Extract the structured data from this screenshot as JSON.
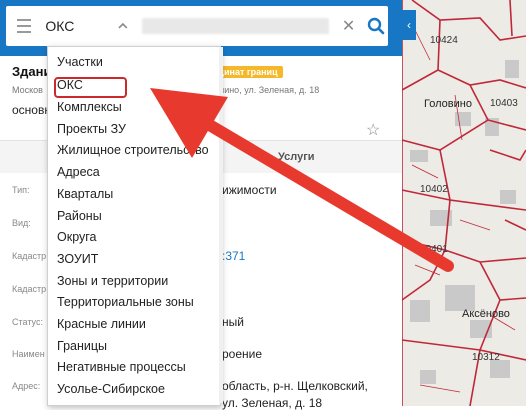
{
  "search": {
    "value": "ОКС",
    "clear_icon": "close-icon",
    "search_icon": "search-icon"
  },
  "object": {
    "title": "Здани",
    "badge": "рдинат границ",
    "subtitle_left": "Москов",
    "subtitle_right": "мино, ул. Зеленая, д. 18",
    "base_label": "основн"
  },
  "tabs": {
    "services": "Услуги"
  },
  "rows": [
    {
      "label": "Тип:",
      "value": "ижимости"
    },
    {
      "label": "Вид:",
      "value": ""
    },
    {
      "label": "Кадастр",
      "value": ":371"
    },
    {
      "label": "Кадастр",
      "value": ""
    },
    {
      "label": "Статус:",
      "value": "ный"
    },
    {
      "label": "Наимен",
      "value": "роение"
    },
    {
      "label": "Адрес:",
      "value": "область, р-н. Щелковский,"
    },
    {
      "label": "",
      "value": "ул. Зеленая, д. 18"
    }
  ],
  "dropdown": {
    "items": [
      "Участки",
      "ОКС",
      "Комплексы",
      "Проекты ЗУ",
      "Жилищное строительство",
      "Адреса",
      "Кварталы",
      "Районы",
      "Округа",
      "ЗОУИТ",
      "Зоны и территории",
      "Территориальные зоны",
      "Красные линии",
      "Границы",
      "Негативные процессы",
      "Усолье-Сибирское"
    ],
    "selected": "ОКС"
  },
  "map": {
    "parcels": [
      "10424",
      "10403",
      "10402",
      "10401",
      "10312"
    ],
    "places": [
      "Головино",
      "Аксёново"
    ],
    "boundary_color": "#c0283a"
  },
  "annotation": {
    "arrow_color": "#e8392e"
  }
}
